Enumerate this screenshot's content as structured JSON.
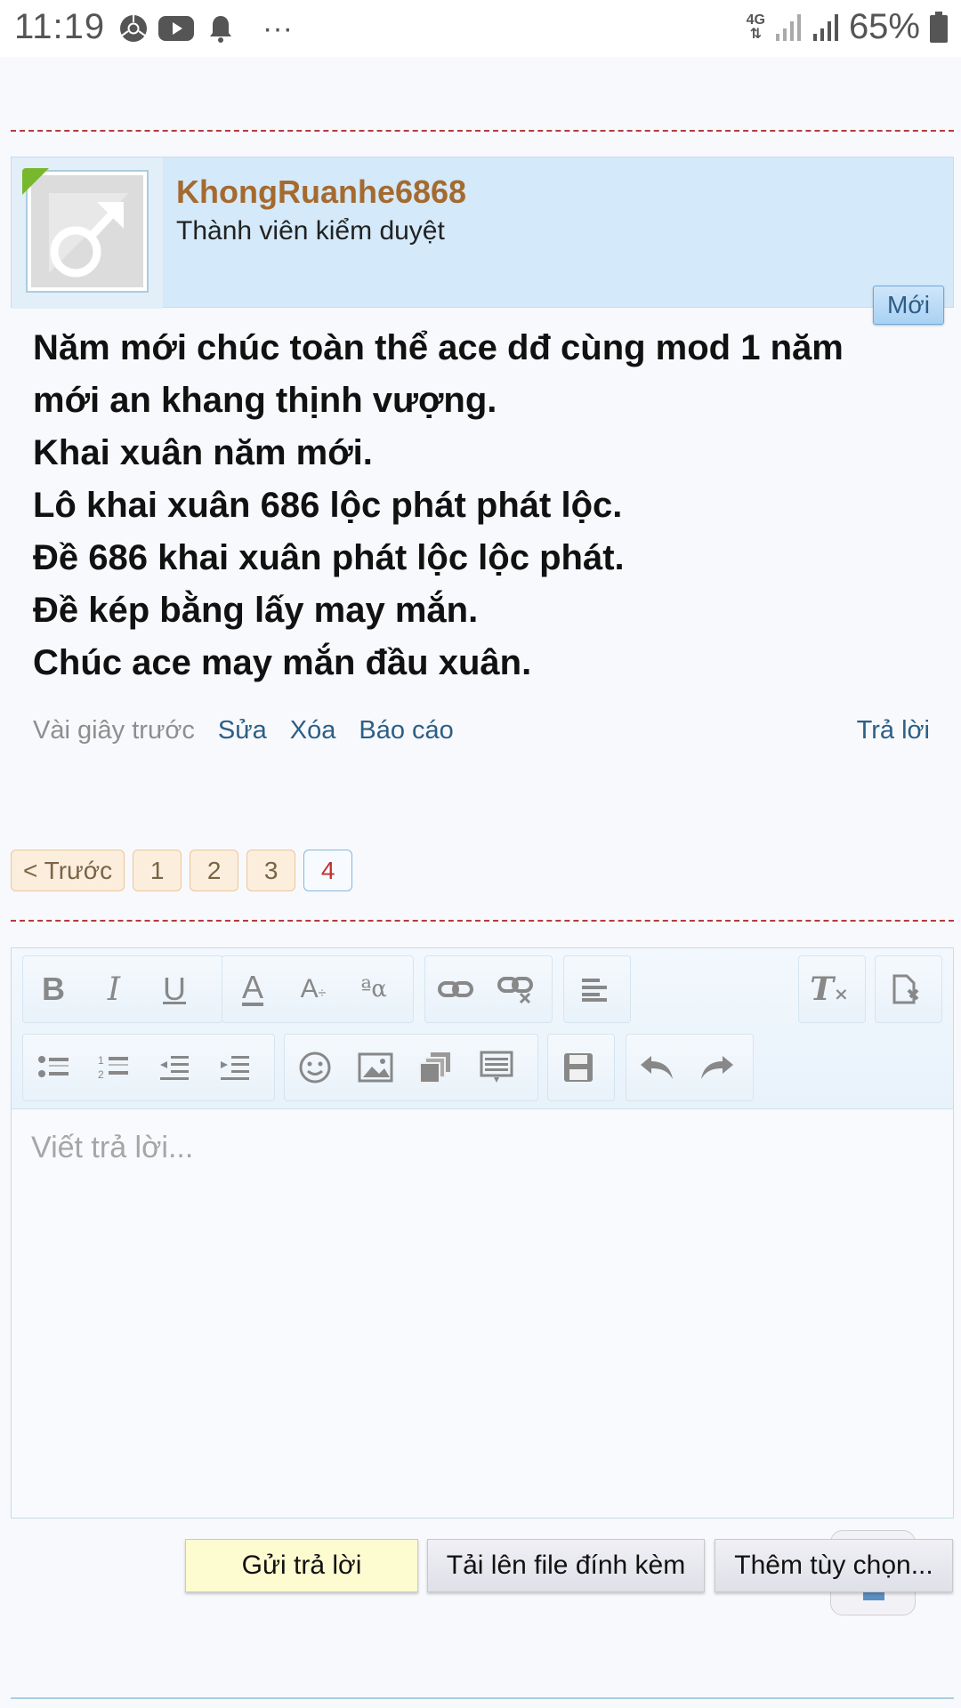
{
  "status_bar": {
    "time": "11:19",
    "network": "4G",
    "battery_pct": "65%",
    "more": "···",
    "icons": [
      "chrome-icon",
      "youtube-icon",
      "notification-bell-icon",
      "signal-icon",
      "battery-icon"
    ]
  },
  "post": {
    "username": "KhongRuanhe6868",
    "user_title": "Thành viên kiểm duyệt",
    "new_badge": "Mới",
    "body_lines": [
      "Năm mới chúc toàn thể ace dđ cùng mod 1 năm",
      "mới an khang thịnh vượng.",
      "Khai xuân năm mới.",
      "Lô khai xuân 686 lộc phát phát lộc.",
      "Đề 686 khai xuân phát lộc lộc phát.",
      "Đề kép bằng lấy may mắn.",
      "Chúc ace may mắn đầu xuân."
    ],
    "time_ago": "Vài giây trước",
    "edit": "Sửa",
    "delete": "Xóa",
    "report": "Báo cáo",
    "reply": "Trả lời",
    "colors": {
      "username": "#a56a2f",
      "header_bg": "#d4e9f9",
      "link": "#2b5f86"
    }
  },
  "pagination": {
    "prev": "< Trước",
    "pages": [
      "1",
      "2",
      "3",
      "4"
    ],
    "current": "4"
  },
  "editor": {
    "placeholder": "Viết trả lời...",
    "toolbar_row1": [
      "bold-icon",
      "italic-icon",
      "underline-icon",
      "text-color-icon",
      "font-size-icon",
      "font-family-icon",
      "link-icon",
      "unlink-icon",
      "align-icon",
      "remove-format-icon",
      "source-icon"
    ],
    "toolbar_row2": [
      "bullet-list-icon",
      "numbered-list-icon",
      "outdent-icon",
      "indent-icon",
      "smiley-icon",
      "image-icon",
      "media-icon",
      "quote-icon",
      "save-draft-icon",
      "undo-icon",
      "redo-icon"
    ]
  },
  "actions": {
    "send": "Gửi trả lời",
    "upload": "Tải lên file đính kèm",
    "more_options": "Thêm tùy chọn..."
  }
}
